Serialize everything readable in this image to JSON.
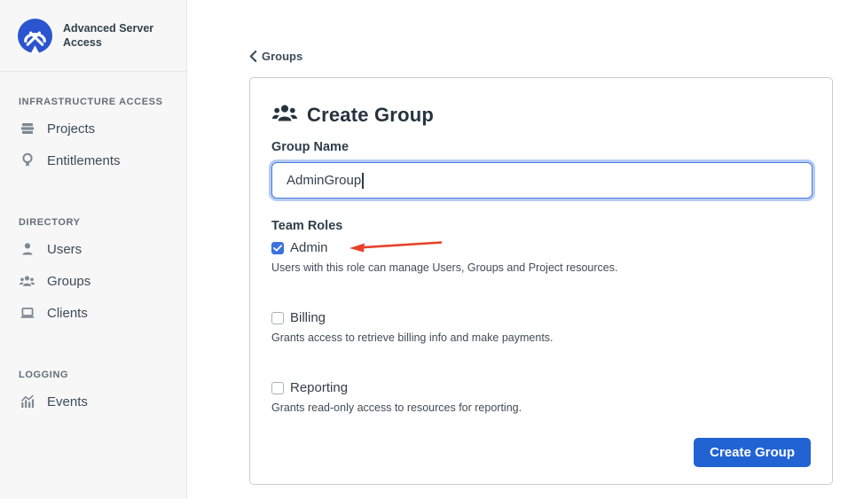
{
  "app": {
    "brand_name": "Advanced Server Access"
  },
  "sidebar": {
    "sections": [
      {
        "label": "INFRASTRUCTURE ACCESS",
        "items": [
          {
            "label": "Projects",
            "icon": "stack-icon"
          },
          {
            "label": "Entitlements",
            "icon": "badge-icon"
          }
        ]
      },
      {
        "label": "DIRECTORY",
        "items": [
          {
            "label": "Users",
            "icon": "user-icon"
          },
          {
            "label": "Groups",
            "icon": "users-icon"
          },
          {
            "label": "Clients",
            "icon": "laptop-icon"
          }
        ]
      },
      {
        "label": "LOGGING",
        "items": [
          {
            "label": "Events",
            "icon": "chart-icon"
          }
        ]
      }
    ]
  },
  "main": {
    "back_link": "Groups",
    "form": {
      "title": "Create Group",
      "group_name_label": "Group Name",
      "group_name_value": "AdminGroup",
      "team_roles_label": "Team Roles",
      "roles": [
        {
          "label": "Admin",
          "checked": true,
          "description": "Users with this role can manage Users, Groups and Project resources."
        },
        {
          "label": "Billing",
          "checked": false,
          "description": "Grants access to retrieve billing info and make payments."
        },
        {
          "label": "Reporting",
          "checked": false,
          "description": "Grants read-only access to resources for reporting."
        }
      ],
      "submit_label": "Create Group"
    }
  },
  "colors": {
    "logo_blue": "#2b55cf",
    "button_blue": "#2163d3",
    "checkbox_blue": "#3b72e0",
    "input_focus_border": "#4a7ce2",
    "annotation_arrow_red": "#e8402a",
    "sidebar_bg": "#f7f7f8",
    "text_dark": "#2e3d49"
  }
}
